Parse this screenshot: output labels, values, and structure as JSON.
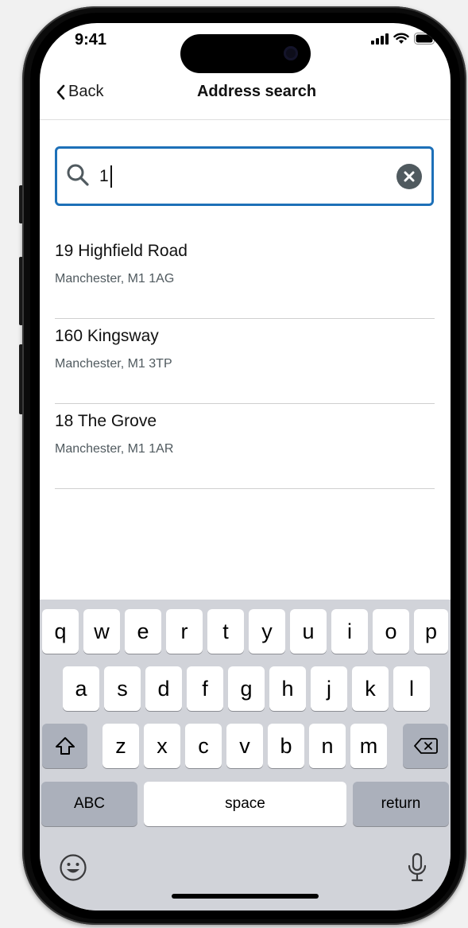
{
  "status": {
    "time": "9:41"
  },
  "nav": {
    "back_label": "Back",
    "title": "Address search"
  },
  "search": {
    "value": "1",
    "placeholder": ""
  },
  "results": [
    {
      "line1": "19 Highfield Road",
      "line2": "Manchester, M1 1AG"
    },
    {
      "line1": "160 Kingsway",
      "line2": "Manchester, M1 3TP"
    },
    {
      "line1": "18 The Grove",
      "line2": "Manchester, M1 1AR"
    }
  ],
  "keyboard": {
    "row1": [
      "q",
      "w",
      "e",
      "r",
      "t",
      "y",
      "u",
      "i",
      "o",
      "p"
    ],
    "row2": [
      "a",
      "s",
      "d",
      "f",
      "g",
      "h",
      "j",
      "k",
      "l"
    ],
    "row3": [
      "z",
      "x",
      "c",
      "v",
      "b",
      "n",
      "m"
    ],
    "abc_label": "ABC",
    "space_label": "space",
    "return_label": "return"
  },
  "colors": {
    "accent": "#1d70b8",
    "secondary_text": "#505a5f",
    "keyboard_bg": "#d1d3d9"
  },
  "icons": [
    "back-chevron-icon",
    "search-icon",
    "clear-icon",
    "shift-icon",
    "delete-icon",
    "emoji-icon",
    "microphone-icon",
    "signal-icon",
    "wifi-icon",
    "battery-icon"
  ]
}
